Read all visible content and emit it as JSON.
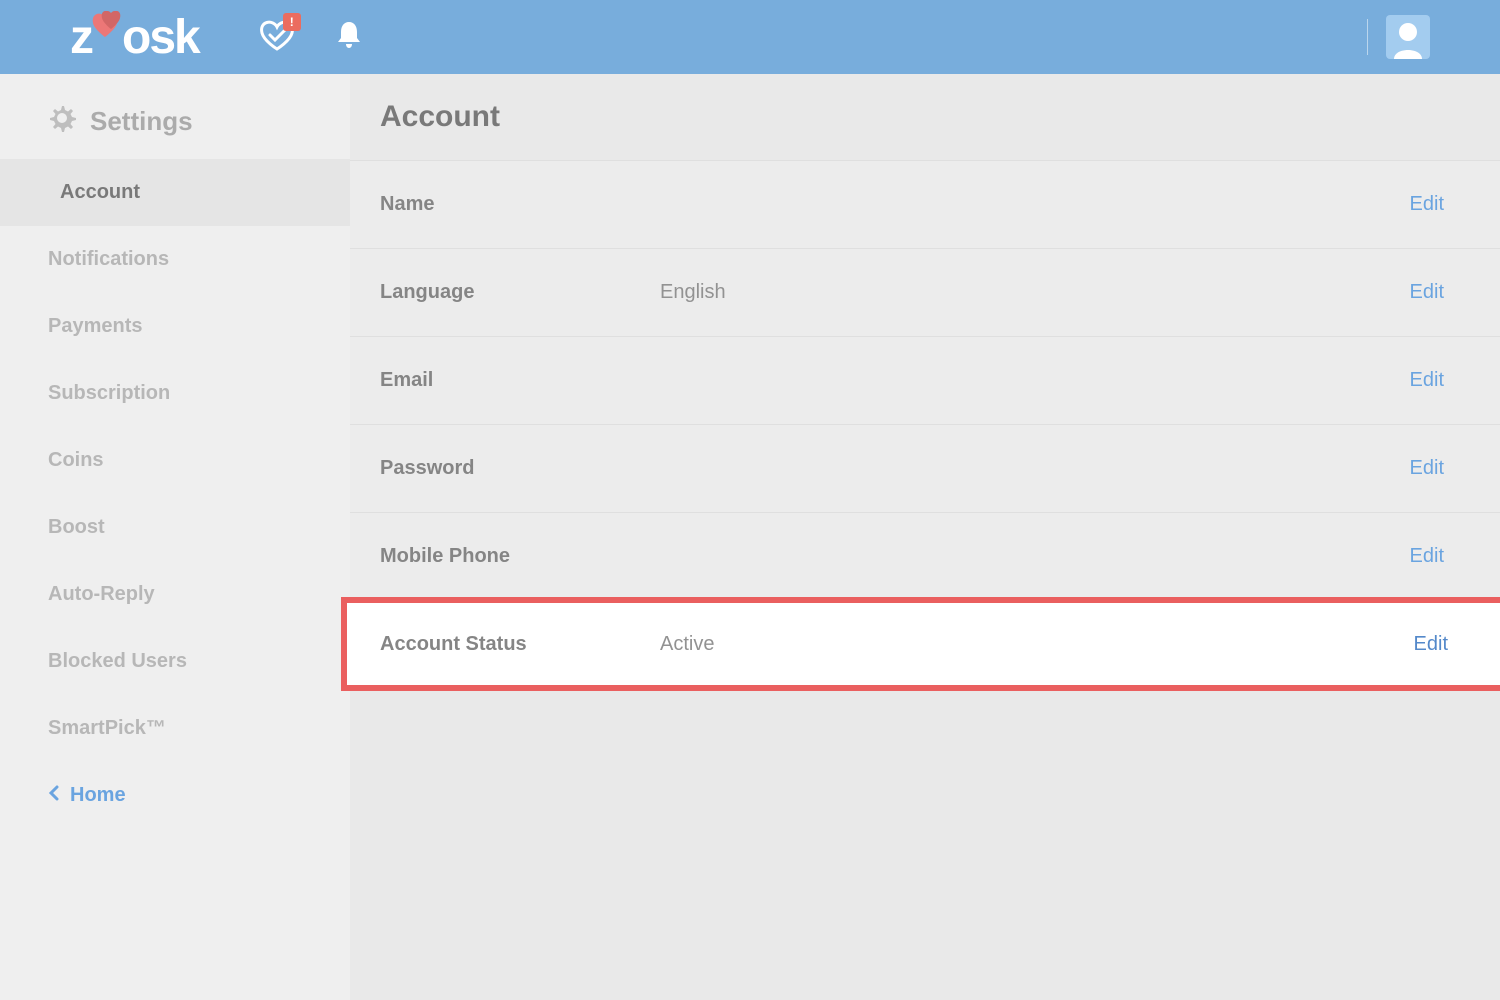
{
  "header": {
    "logo_text": "zoosk",
    "notif_badge": "!"
  },
  "sidebar": {
    "title": "Settings",
    "items": [
      {
        "label": "Account",
        "active": true
      },
      {
        "label": "Notifications",
        "active": false
      },
      {
        "label": "Payments",
        "active": false
      },
      {
        "label": "Subscription",
        "active": false
      },
      {
        "label": "Coins",
        "active": false
      },
      {
        "label": "Boost",
        "active": false
      },
      {
        "label": "Auto-Reply",
        "active": false
      },
      {
        "label": "Blocked Users",
        "active": false
      },
      {
        "label": "SmartPick™",
        "active": false
      }
    ],
    "home_label": "Home"
  },
  "main": {
    "title": "Account",
    "edit_label": "Edit",
    "rows": [
      {
        "label": "Name",
        "value": "",
        "highlight": false
      },
      {
        "label": "Language",
        "value": "English",
        "highlight": false
      },
      {
        "label": "Email",
        "value": "",
        "highlight": false
      },
      {
        "label": "Password",
        "value": "",
        "highlight": false
      },
      {
        "label": "Mobile Phone",
        "value": "",
        "highlight": false
      },
      {
        "label": "Account Status",
        "value": "Active",
        "highlight": true
      }
    ]
  }
}
